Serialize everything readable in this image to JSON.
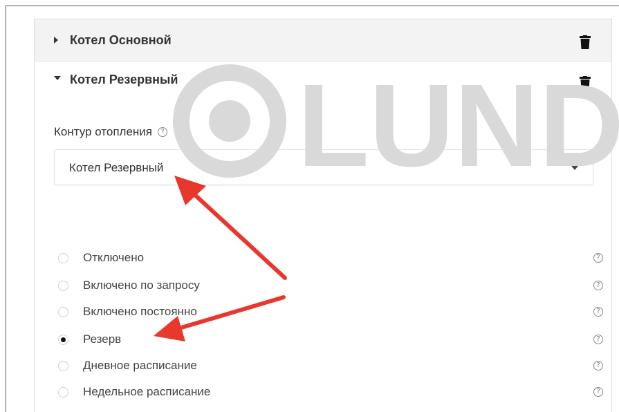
{
  "accordion": {
    "main_boiler": {
      "title": "Котел Основной",
      "expanded": false
    },
    "reserve_boiler": {
      "title": "Котел Резервный",
      "expanded": true
    }
  },
  "heating_circuit": {
    "label": "Контур отопления",
    "help_glyph": "?",
    "selected_value": "Котел Резервный"
  },
  "modes": {
    "help_glyph": "?",
    "items": [
      {
        "label": "Отключено",
        "checked": false
      },
      {
        "label": "Включено по запросу",
        "checked": false
      },
      {
        "label": "Включено постоянно",
        "checked": false
      },
      {
        "label": "Резерв",
        "checked": true
      },
      {
        "label": "Дневное расписание",
        "checked": false
      },
      {
        "label": "Недельное расписание",
        "checked": false
      }
    ]
  },
  "watermark": {
    "text": "LUNDA",
    "color": "#d9d9d9"
  },
  "annotation_color": "#e8372c",
  "icons": [
    "caret-right-icon",
    "caret-down-icon",
    "trash-icon",
    "help-icon",
    "chevron-down-icon",
    "radio-icon"
  ]
}
